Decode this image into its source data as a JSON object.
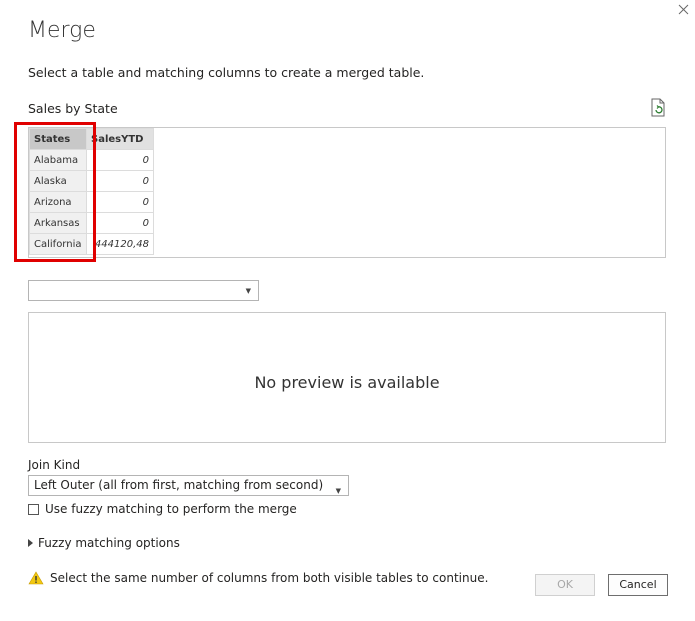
{
  "dialog": {
    "title": "Merge",
    "subtitle": "Select a table and matching columns to create a merged table."
  },
  "first_table": {
    "name": "Sales by State",
    "columns": [
      "States",
      "SalesYTD"
    ],
    "rows": [
      {
        "state": "Alabama",
        "sales": "0"
      },
      {
        "state": "Alaska",
        "sales": "0"
      },
      {
        "state": "Arizona",
        "sales": "0"
      },
      {
        "state": "Arkansas",
        "sales": "0"
      },
      {
        "state": "California",
        "sales": "444120,48"
      }
    ]
  },
  "second_table": {
    "selected": "",
    "preview_message": "No preview is available"
  },
  "join": {
    "label": "Join Kind",
    "selected": "Left Outer (all from first, matching from second)",
    "fuzzy_checkbox_label": "Use fuzzy matching to perform the merge",
    "fuzzy_checked": false,
    "fuzzy_options_label": "Fuzzy matching options"
  },
  "footer": {
    "warning": "Select the same number of columns from both visible tables to continue.",
    "ok_label": "OK",
    "cancel_label": "Cancel"
  },
  "colors": {
    "highlight": "#e00000",
    "warning": "#f2c811"
  }
}
